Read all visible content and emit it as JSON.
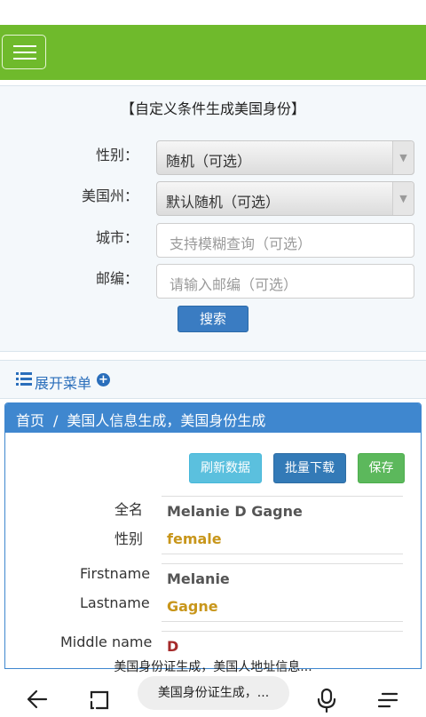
{
  "filter": {
    "title": "【自定义条件生成美国身份】",
    "gender_label": "性别：",
    "gender_value": "随机（可选）",
    "state_label": "美国州：",
    "state_value": "默认随机（可选）",
    "city_label": "城市：",
    "city_placeholder": "支持模糊查询（可选）",
    "zip_label": "邮编：",
    "zip_placeholder": "请输入邮编（可选）",
    "search_label": "搜索"
  },
  "menu": {
    "label": "展开菜单"
  },
  "panel": {
    "breadcrumb_home": "首页",
    "breadcrumb_sep": "/",
    "breadcrumb_current": "美国人信息生成，美国身份生成",
    "refresh_label": "刷新数据",
    "batch_label": "批量下载",
    "save_label": "保存",
    "fields": {
      "fullname_label": "全名",
      "fullname_value": "Melanie D Gagne",
      "gender_label": "性别",
      "gender_value": "female",
      "firstname_label": "Firstname",
      "firstname_value": "Melanie",
      "lastname_label": "Lastname",
      "lastname_value": "Gagne",
      "middlename_label": "Middle name",
      "middlename_value": "D"
    }
  },
  "browser": {
    "page_caption": "美国身份证生成，美国人地址信息...",
    "url_text": "美国身份证生成，..."
  },
  "colors": {
    "brand_green": "#6fba2c",
    "primary_blue": "#3f87cf",
    "value_gold": "#c8961b",
    "value_red": "#a52a2a"
  },
  "icons": [
    "hamburger-icon",
    "list-icon",
    "plus-circle-icon",
    "back-arrow-icon",
    "tabs-icon",
    "microphone-icon",
    "menu-lines-icon"
  ]
}
